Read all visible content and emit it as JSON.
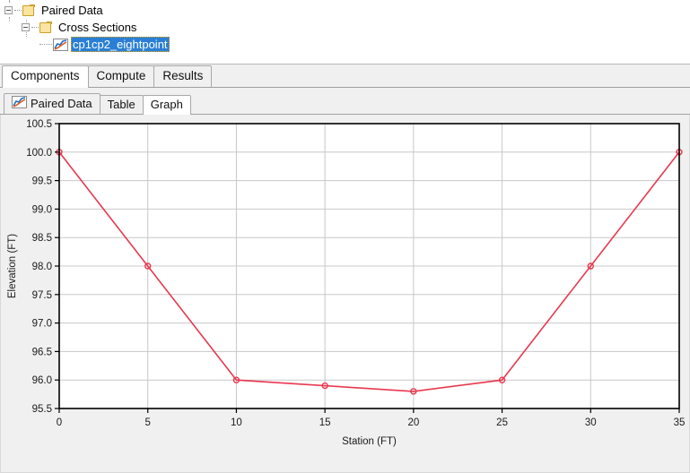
{
  "tree": {
    "nodes": [
      {
        "label": "Paired Data",
        "icon": "folder-icon",
        "depth": 0,
        "selected": false
      },
      {
        "label": "Cross Sections",
        "icon": "folder-icon",
        "depth": 1,
        "selected": false
      },
      {
        "label": "cp1cp2_eightpoint",
        "icon": "paired-data-chart-icon",
        "depth": 2,
        "selected": true
      }
    ]
  },
  "primary_tabs": [
    {
      "label": "Components",
      "active": true
    },
    {
      "label": "Compute",
      "active": false
    },
    {
      "label": "Results",
      "active": false
    }
  ],
  "secondary_tabs": [
    {
      "label": "Paired Data",
      "active": false,
      "icon": "paired-data-chart-icon"
    },
    {
      "label": "Table",
      "active": false,
      "icon": ""
    },
    {
      "label": "Graph",
      "active": true,
      "icon": ""
    }
  ],
  "colors": {
    "series": "#e8384f",
    "selection": "#2a7fd4",
    "folder": "#fbe3a0",
    "plot_bg": "#ffffff",
    "panel_bg": "#f0f0f0",
    "grid": "#c8c8c8"
  },
  "chart_data": {
    "type": "line",
    "title": "",
    "xlabel": "Station (FT)",
    "ylabel": "Elevation (FT)",
    "xlim": [
      0,
      35
    ],
    "ylim": [
      95.5,
      100.5
    ],
    "xticks": [
      0,
      5,
      10,
      15,
      20,
      25,
      30,
      35
    ],
    "xticklabels": [
      "0",
      "5",
      "10",
      "15",
      "20",
      "25",
      "30",
      "35"
    ],
    "yticks": [
      95.5,
      96.0,
      96.5,
      97.0,
      97.5,
      98.0,
      98.5,
      99.0,
      99.5,
      100.0,
      100.5
    ],
    "yticklabels": [
      "95.5",
      "96.0",
      "96.5",
      "97.0",
      "97.5",
      "98.0",
      "98.5",
      "99.0",
      "99.5",
      "100.0",
      "100.5"
    ],
    "grid": true,
    "legend": false,
    "markers": "open-circle",
    "series": [
      {
        "name": "cp1cp2_eightpoint",
        "color": "#e8384f",
        "x": [
          0,
          5,
          10,
          15,
          20,
          25,
          30,
          35
        ],
        "y": [
          100.0,
          98.0,
          96.0,
          95.9,
          95.8,
          96.0,
          98.0,
          100.0
        ]
      }
    ]
  }
}
